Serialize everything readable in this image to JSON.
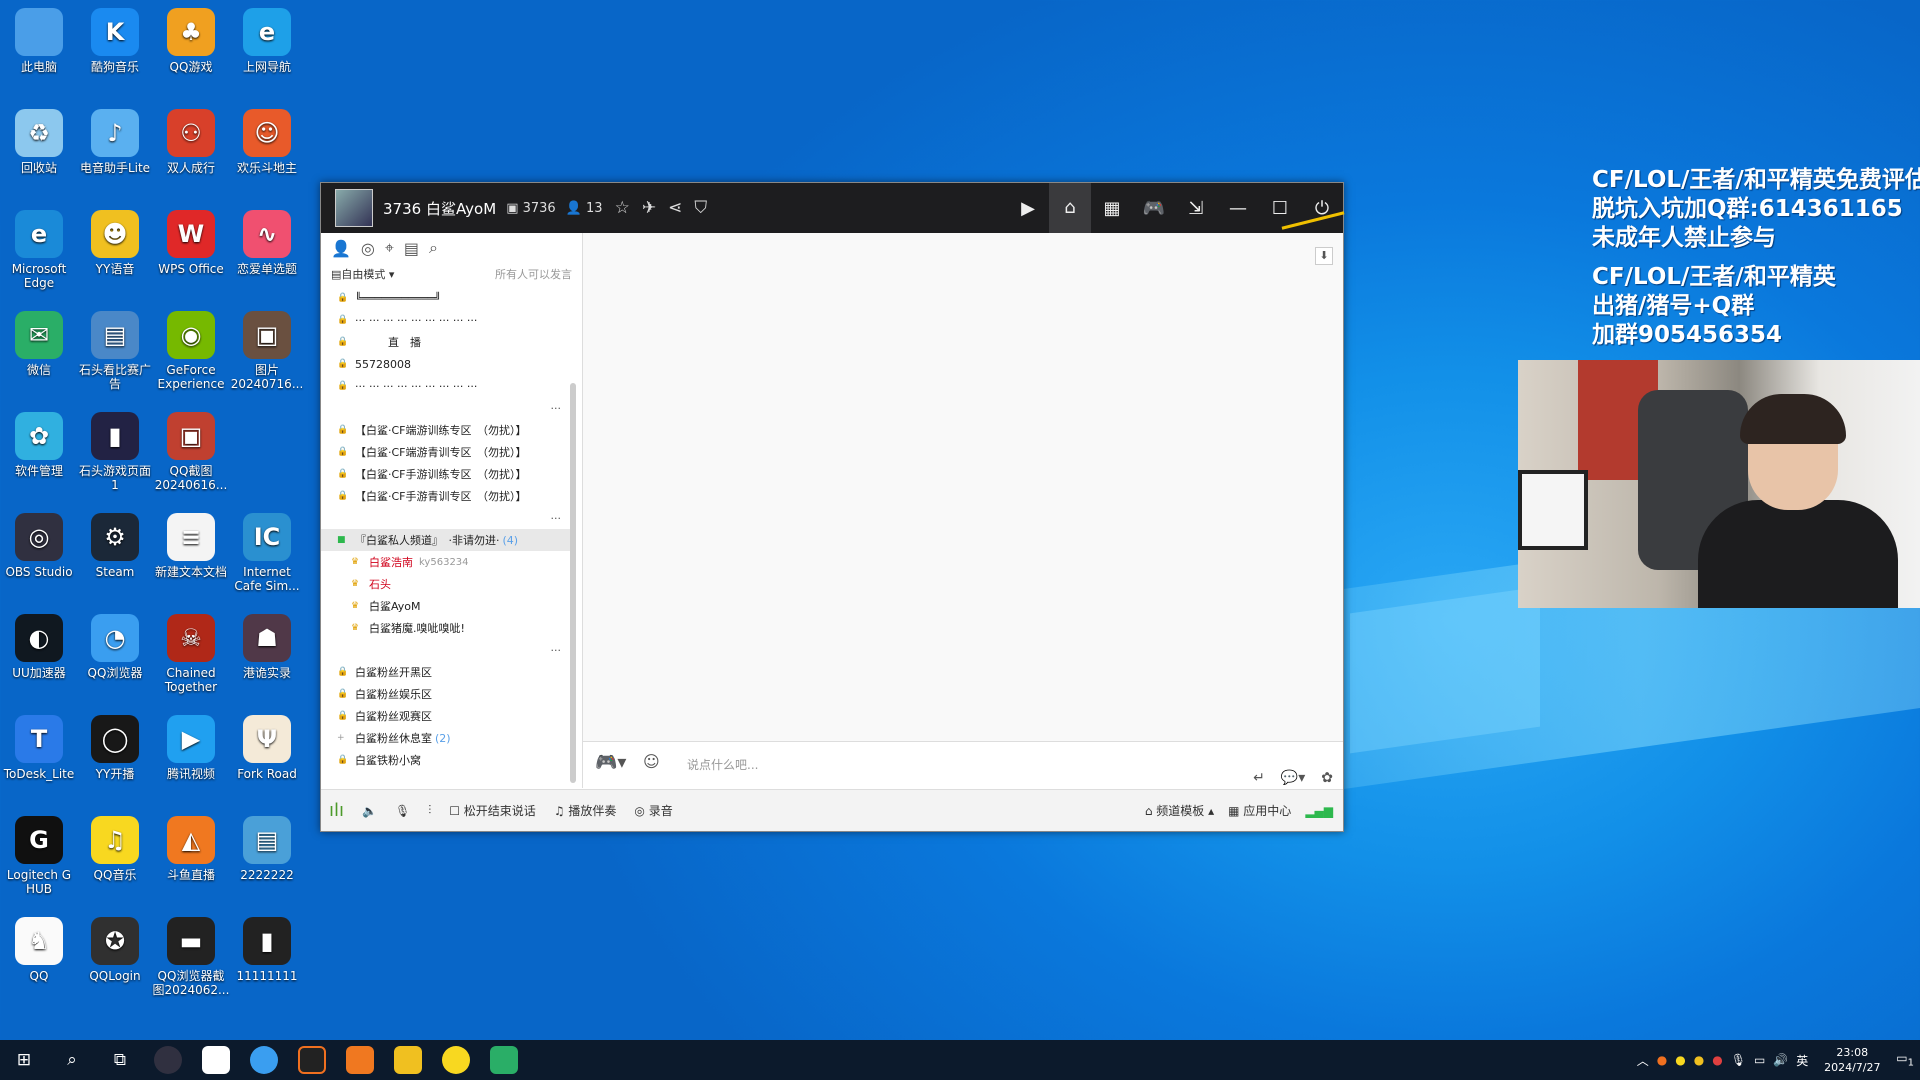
{
  "desktop": {
    "icons": [
      {
        "label": "此电脑",
        "icon": "computer-icon",
        "color": "#4a9ee8"
      },
      {
        "label": "酷狗音乐",
        "icon": "kugou-icon",
        "color": "#1a8af0",
        "glyph": "K"
      },
      {
        "label": "QQ游戏",
        "icon": "qq-game-icon",
        "color": "#f0a020",
        "glyph": "♣"
      },
      {
        "label": "上网导航",
        "icon": "ie-icon",
        "color": "#1ea0e8",
        "glyph": "e"
      },
      {
        "label": "回收站",
        "icon": "recycle-bin-icon",
        "color": "#8cc8ee",
        "glyph": "♻"
      },
      {
        "label": "电音助手Lite",
        "icon": "music-note-icon",
        "color": "#5ab0f0",
        "glyph": "♪"
      },
      {
        "label": "双人成行",
        "icon": "it-takes-two-icon",
        "color": "#d8402a",
        "glyph": "⚇"
      },
      {
        "label": "欢乐斗地主",
        "icon": "doudizhu-icon",
        "color": "#e85a2a",
        "glyph": "☺"
      },
      {
        "label": "Microsoft Edge",
        "icon": "edge-icon",
        "color": "#1a8ad8",
        "glyph": "e"
      },
      {
        "label": "YY语音",
        "icon": "yy-icon",
        "color": "#f0c020",
        "glyph": "☻"
      },
      {
        "label": "WPS Office",
        "icon": "wps-icon",
        "color": "#e02828",
        "glyph": "W"
      },
      {
        "label": "恋爱单选题",
        "icon": "heartbeat-icon",
        "color": "#f05070",
        "glyph": "∿"
      },
      {
        "label": "微信",
        "icon": "wechat-icon",
        "color": "#2aae67",
        "glyph": "✉"
      },
      {
        "label": "石头看比赛广告",
        "icon": "file-icon",
        "color": "#4a88c8",
        "glyph": "▤"
      },
      {
        "label": "GeForce Experience",
        "icon": "nvidia-icon",
        "color": "#76b900",
        "glyph": "◉"
      },
      {
        "label": "图片20240716...",
        "icon": "image-icon",
        "color": "#6a5040",
        "glyph": "▣"
      },
      {
        "label": "软件管理",
        "icon": "software-manager-icon",
        "color": "#30b0e0",
        "glyph": "✿"
      },
      {
        "label": "石头游戏页面1",
        "icon": "file-icon",
        "color": "#224",
        "glyph": "▮"
      },
      {
        "label": "QQ截图20240616...",
        "icon": "image-icon",
        "color": "#c04030",
        "glyph": "▣"
      },
      {
        "label": "",
        "icon": "blank-icon",
        "color": "transparent",
        "glyph": ""
      },
      {
        "label": "OBS Studio",
        "icon": "obs-icon",
        "color": "#303040",
        "glyph": "◎"
      },
      {
        "label": "Steam",
        "icon": "steam-icon",
        "color": "#1b2838",
        "glyph": "⚙"
      },
      {
        "label": "新建文本文档",
        "icon": "text-document-icon",
        "color": "#f4f4f4",
        "glyph": "≡"
      },
      {
        "label": "Internet Cafe Sim...",
        "icon": "ics2-icon",
        "color": "#2a90d0",
        "glyph": "IC"
      },
      {
        "label": "UU加速器",
        "icon": "uu-icon",
        "color": "#101820",
        "glyph": "◐"
      },
      {
        "label": "QQ浏览器",
        "icon": "qq-browser-icon",
        "color": "#3a9ef0",
        "glyph": "◔"
      },
      {
        "label": "Chained Together",
        "icon": "chained-together-icon",
        "color": "#b02818",
        "glyph": "☠"
      },
      {
        "label": "港诡实录",
        "icon": "game-icon",
        "color": "#503848",
        "glyph": "☗"
      },
      {
        "label": "ToDesk_Lite",
        "icon": "todesk-icon",
        "color": "#2a7ae8",
        "glyph": "T"
      },
      {
        "label": "YY开播",
        "icon": "yy-live-icon",
        "color": "#181818",
        "glyph": "◯"
      },
      {
        "label": "腾讯视频",
        "icon": "tencent-video-icon",
        "color": "#20a0f0",
        "glyph": "▶"
      },
      {
        "label": "Fork Road",
        "icon": "fork-road-icon",
        "color": "#f4ead8",
        "glyph": "Ψ"
      },
      {
        "label": "Logitech G HUB",
        "icon": "logitech-icon",
        "color": "#101010",
        "glyph": "G"
      },
      {
        "label": "QQ音乐",
        "icon": "qq-music-icon",
        "color": "#f8d820",
        "glyph": "♫"
      },
      {
        "label": "斗鱼直播",
        "icon": "douyu-icon",
        "color": "#f07820",
        "glyph": "◭"
      },
      {
        "label": "2222222",
        "icon": "file-icon",
        "color": "#4aa0d8",
        "glyph": "▤"
      },
      {
        "label": "QQ",
        "icon": "qq-icon",
        "color": "#fafafa",
        "glyph": "♞"
      },
      {
        "label": "QQLogin",
        "icon": "cf-icon",
        "color": "#303030",
        "glyph": "✪"
      },
      {
        "label": "QQ浏览器截图2024062...",
        "icon": "image-icon",
        "color": "#222",
        "glyph": "▬"
      },
      {
        "label": "11111111",
        "icon": "file-icon",
        "color": "#222",
        "glyph": "▮"
      }
    ]
  },
  "window": {
    "title": "3736 白鲨AyoM",
    "channel_id": "3736",
    "members": "13",
    "mode": "自由模式",
    "speak_rule": "所有人可以发言",
    "list": [
      {
        "type": "text",
        "text": "╚═══════════╝"
      },
      {
        "type": "text",
        "text": "··· ··· ··· ··· ··· ··· ··· ··· ···"
      },
      {
        "type": "text",
        "text": "　　　直　播"
      },
      {
        "type": "text",
        "text": "55728008"
      },
      {
        "type": "text",
        "text": "··· ··· ··· ··· ··· ··· ··· ··· ···"
      },
      {
        "type": "dots",
        "text": "···"
      },
      {
        "type": "text",
        "text": "【白鲨·CF端游训练专区　（勿扰）】"
      },
      {
        "type": "text",
        "text": "【白鲨·CF端游青训专区　（勿扰）】"
      },
      {
        "type": "text",
        "text": "【白鲨·CF手游训练专区　（勿扰）】"
      },
      {
        "type": "text",
        "text": "【白鲨·CF手游青训专区　（勿扰）】"
      },
      {
        "type": "dots",
        "text": "···"
      },
      {
        "type": "channel",
        "text": "『白鲨私人频道』　·非请勿进·",
        "count": "(4)"
      },
      {
        "type": "user",
        "text": "白鲨浩南",
        "extra": "ky563234",
        "red": true
      },
      {
        "type": "user",
        "text": "石头",
        "extra": "",
        "red": true
      },
      {
        "type": "user",
        "text": "白鲨AyoM",
        "extra": "",
        "red": false
      },
      {
        "type": "user",
        "text": "白鲨猪魔.嗅呲嗅呲!",
        "extra": "",
        "red": false
      },
      {
        "type": "dots",
        "text": "···"
      },
      {
        "type": "text",
        "text": "白鲨粉丝开黑区"
      },
      {
        "type": "text",
        "text": "白鲨粉丝娱乐区"
      },
      {
        "type": "text",
        "text": "白鲨粉丝观赛区"
      },
      {
        "type": "channel2",
        "text": "白鲨粉丝休息室",
        "count": "(2)"
      },
      {
        "type": "text",
        "text": "白鲨铁粉小窝"
      }
    ],
    "input_placeholder": "说点什么吧...",
    "bottom": {
      "release_talk": "松开结束说话",
      "accompany": "播放伴奏",
      "record": "录音",
      "template": "频道模板",
      "app_center": "应用中心"
    }
  },
  "overlay": {
    "line1": "CF/LOL/王者/和平精英免费评估",
    "line2": "脱坑入坑加Q群:614361165",
    "line3": "未成年人禁止参与",
    "line4": "CF/LOL/王者/和平精英",
    "line5": "出猪/猪号+Q群",
    "line6": "加群905456354"
  },
  "taskbar": {
    "time": "23:08",
    "date": "2024/7/27",
    "ime": "英",
    "notification_count": "1"
  }
}
